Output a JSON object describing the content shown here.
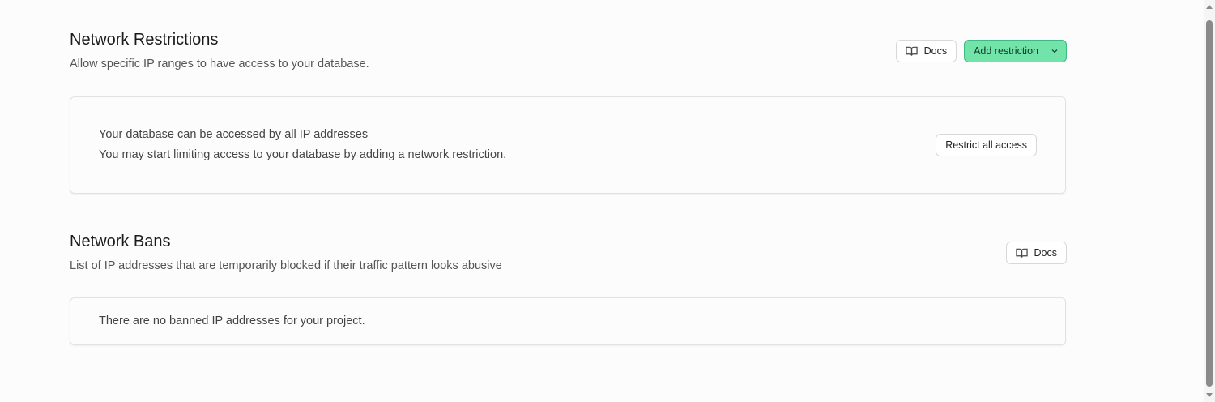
{
  "restrictions": {
    "title": "Network Restrictions",
    "subtitle": "Allow specific IP ranges to have access to your database.",
    "docs_label": "Docs",
    "add_label": "Add restriction",
    "card": {
      "line1": "Your database can be accessed by all IP addresses",
      "line2": "You may start limiting access to your database by adding a network restriction.",
      "restrict_label": "Restrict all access"
    }
  },
  "bans": {
    "title": "Network Bans",
    "subtitle": "List of IP addresses that are temporarily blocked if their traffic pattern looks abusive",
    "docs_label": "Docs",
    "empty_text": "There are no banned IP addresses for your project."
  },
  "icons": {
    "docs": "book-icon",
    "add_dropdown": "chevron-down-icon"
  },
  "colors": {
    "primary": "#72e3a9",
    "primary_border": "#3fb884"
  }
}
